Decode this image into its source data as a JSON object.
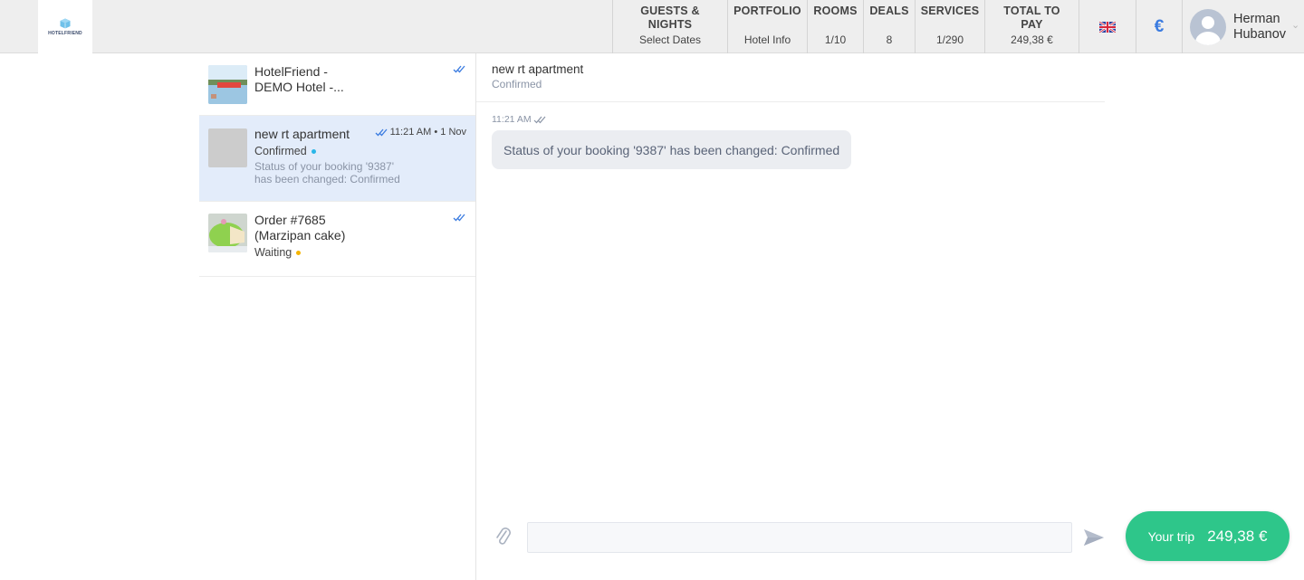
{
  "header": {
    "logo_text": "HOTELFRIEND",
    "nav": [
      {
        "title": "GUESTS & NIGHTS",
        "value": "Select Dates"
      },
      {
        "title": "PORTFOLIO",
        "value": "Hotel Info"
      },
      {
        "title": "ROOMS",
        "value": "1/10"
      },
      {
        "title": "DEALS",
        "value": "8"
      },
      {
        "title": "SERVICES",
        "value": "1/290"
      },
      {
        "title": "TOTAL TO PAY",
        "value": "249,38 €"
      }
    ],
    "language_icon": "uk-flag-icon",
    "currency_symbol": "€",
    "user": {
      "first_name": "Herman",
      "last_name": "Hubanov"
    }
  },
  "conversations": [
    {
      "title_line1": "HotelFriend -",
      "title_line2": "DEMO Hotel -...",
      "status": "",
      "preview_line1": "",
      "preview_line2": "",
      "time": "",
      "read": true
    },
    {
      "title_line1": "new rt apartment",
      "title_line2": "",
      "status": "Confirmed",
      "status_color": "#29b6e8",
      "preview_line1": "Status of your booking '9387'",
      "preview_line2": "has been changed: Confirmed",
      "time": "11:21 AM • 1 Nov",
      "read": true,
      "selected": true
    },
    {
      "title_line1": "Order #7685",
      "title_line2": "(Marzipan cake)",
      "status": "Waiting",
      "status_color": "#f5b400",
      "preview_line1": "",
      "preview_line2": "",
      "time": "",
      "read": true
    }
  ],
  "chat": {
    "title": "new rt apartment",
    "subtitle": "Confirmed",
    "messages": [
      {
        "time": "11:21 AM",
        "text": "Status of your booking '9387' has been changed: Confirmed"
      }
    ],
    "input_value": "",
    "input_placeholder": ""
  },
  "trip_button": {
    "label": "Your trip",
    "amount": "249,38 €"
  },
  "colors": {
    "accent_blue": "#3a7be0",
    "trip_green": "#2ec68a",
    "selected_bg": "#e3ecfa"
  }
}
